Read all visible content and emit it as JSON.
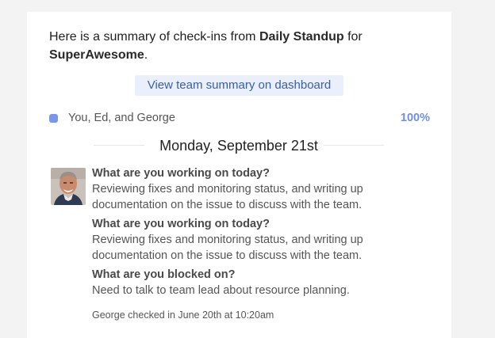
{
  "intro": {
    "prefix": "Here is a summary of check-ins from ",
    "meeting": "Daily Standup",
    "middle": " for ",
    "team": "SuperAwesome",
    "suffix": "."
  },
  "dashboard_button": "View team summary on dashboard",
  "team_summary": {
    "members": "You, Ed, and George",
    "percent": "100%"
  },
  "date_heading": "Monday, September 21st",
  "checkin": {
    "entries": [
      {
        "question": "What are you working on today?",
        "answer": "Reviewing fixes and monitoring status, and writing up documentation on the issue to discuss with the team."
      },
      {
        "question": "What are you working on today?",
        "answer": "Reviewing fixes and monitoring status, and writing up documentation on the issue to discuss with the team."
      },
      {
        "question": "What are you blocked on?",
        "answer": "Need to talk to team lead about resource planning."
      }
    ],
    "footer": "George checked in June 20th at 10:20am"
  },
  "colors": {
    "accent": "#6f8fe0",
    "button_bg": "#e9f0fb",
    "button_text": "#3b5ea8",
    "dot": "#7b96e8"
  }
}
